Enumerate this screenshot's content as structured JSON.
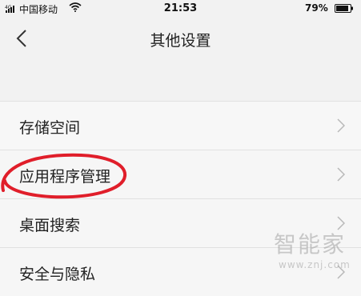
{
  "status_bar": {
    "carrier": "中国移动",
    "time": "21:53",
    "battery": "79%",
    "icons": [
      "signal-icon",
      "wifi-icon",
      "battery-icon"
    ]
  },
  "nav": {
    "title": "其他设置",
    "back_icon": "chevron-left-icon"
  },
  "settings": {
    "items": [
      {
        "label": "存储空间"
      },
      {
        "label": "应用程序管理"
      },
      {
        "label": "桌面搜索"
      },
      {
        "label": "安全与隐私"
      }
    ]
  },
  "annotation": {
    "color": "#e01e2a"
  },
  "watermark": {
    "text": "智能家",
    "url": "www.znj.com"
  }
}
